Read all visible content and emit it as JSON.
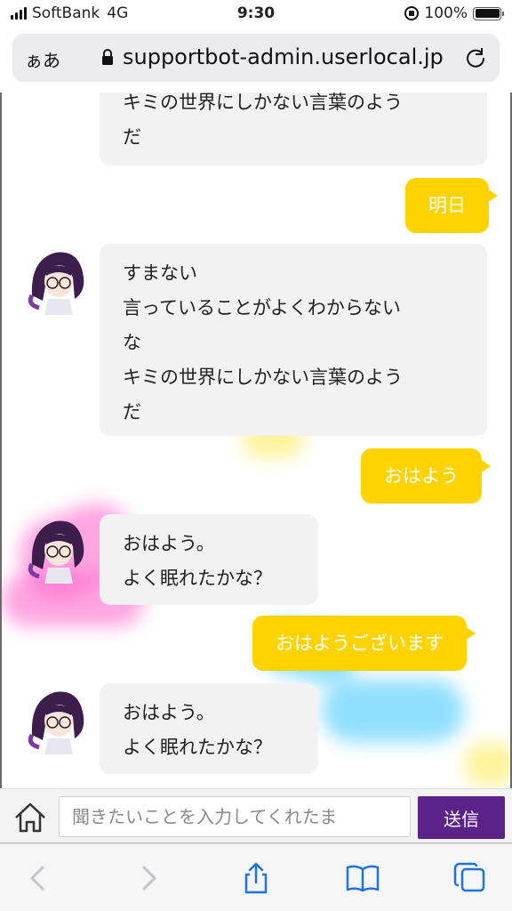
{
  "status": {
    "carrier": "SoftBank",
    "network": "4G",
    "time": "9:30",
    "battery": "100%"
  },
  "browser": {
    "text_size_label": "ぁあ",
    "url": "supportbot-admin.userlocal.jp"
  },
  "messages": [
    {
      "from": "bot",
      "lines": [
        "キミの世界にしかない言葉のよう",
        "だ"
      ]
    },
    {
      "from": "user",
      "text": "明日"
    },
    {
      "from": "bot",
      "lines": [
        "すまない",
        "言っていることがよくわからない",
        "な",
        "キミの世界にしかない言葉のよう",
        "だ"
      ]
    },
    {
      "from": "user",
      "text": "おはよう"
    },
    {
      "from": "bot",
      "lines": [
        "おはよう。",
        "よく眠れたかな？"
      ]
    },
    {
      "from": "user",
      "text": "おはようございます"
    },
    {
      "from": "bot",
      "lines": [
        "おはよう。",
        "よく眠れたかな？"
      ]
    }
  ],
  "input": {
    "placeholder": "聞きたいことを入力してくれたま",
    "send_label": "送信"
  },
  "colors": {
    "user_bubble": "#ffd300",
    "bot_bubble": "#f2f2f2",
    "send_button": "#5b2389"
  },
  "icons": {
    "home": "home-icon",
    "back": "back-icon",
    "forward": "forward-icon",
    "share": "share-icon",
    "bookmarks": "book-icon",
    "tabs": "tabs-icon"
  }
}
